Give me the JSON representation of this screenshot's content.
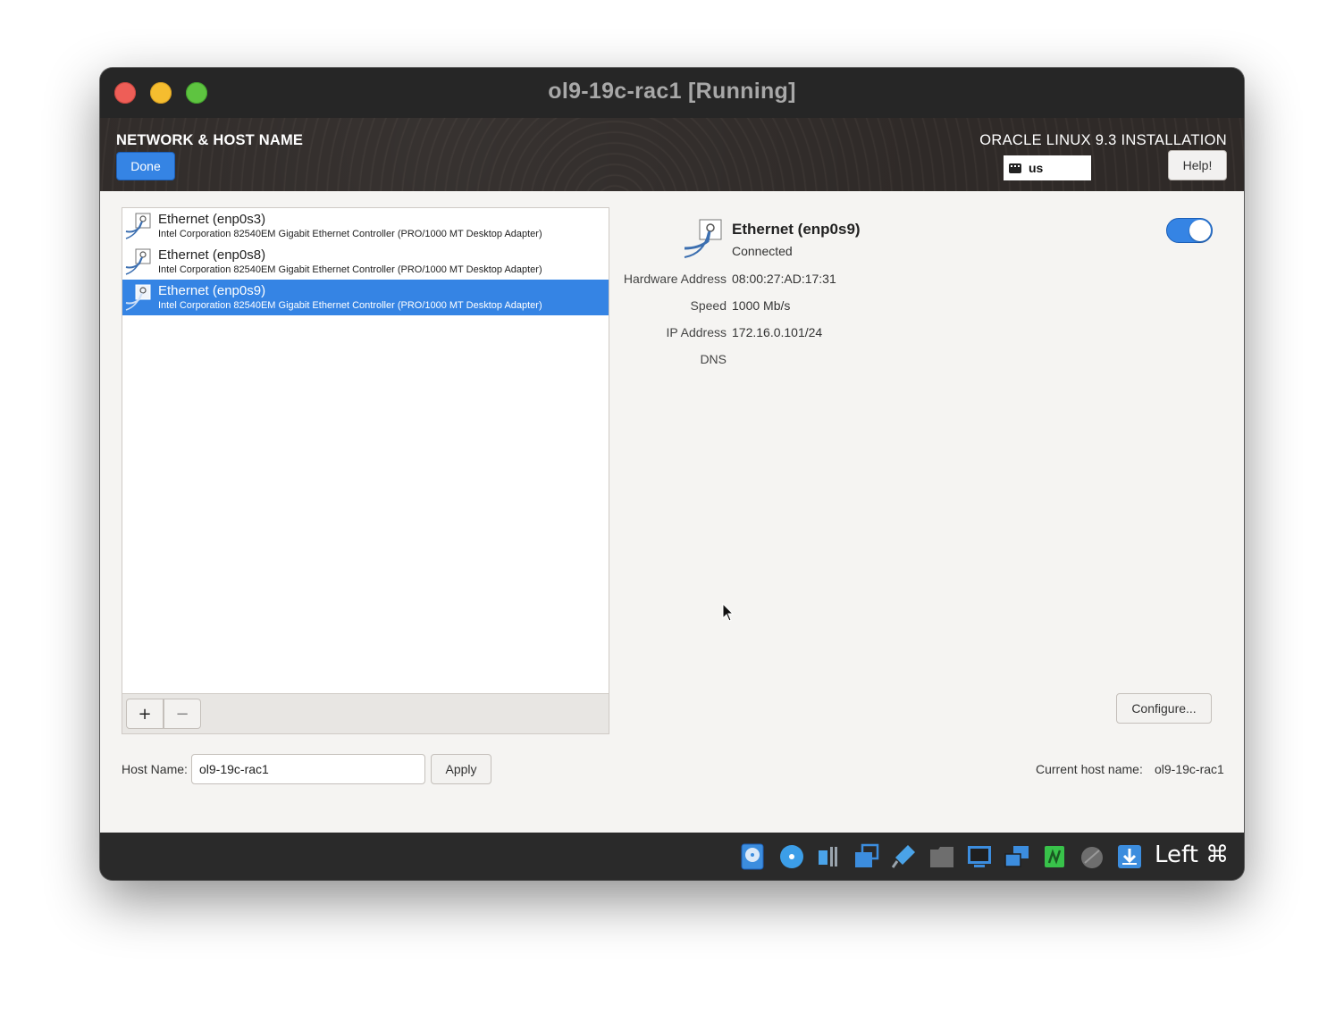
{
  "window": {
    "title": "ol9-19c-rac1 [Running]"
  },
  "header": {
    "spoke_title": "NETWORK & HOST NAME",
    "done_label": "Done",
    "product_title": "ORACLE LINUX 9.3 INSTALLATION",
    "keyboard_layout": "us",
    "help_label": "Help!"
  },
  "devices": [
    {
      "name": "Ethernet (enp0s3)",
      "description": "Intel Corporation 82540EM Gigabit Ethernet Controller (PRO/1000 MT Desktop Adapter)",
      "selected": false
    },
    {
      "name": "Ethernet (enp0s8)",
      "description": "Intel Corporation 82540EM Gigabit Ethernet Controller (PRO/1000 MT Desktop Adapter)",
      "selected": false
    },
    {
      "name": "Ethernet (enp0s9)",
      "description": "Intel Corporation 82540EM Gigabit Ethernet Controller (PRO/1000 MT Desktop Adapter)",
      "selected": true
    }
  ],
  "list_toolbar": {
    "add_label": "+",
    "remove_label": "−"
  },
  "detail": {
    "name": "Ethernet (enp0s9)",
    "status": "Connected",
    "enabled": true,
    "properties": [
      {
        "label": "Hardware Address",
        "value": "08:00:27:AD:17:31"
      },
      {
        "label": "Speed",
        "value": "1000 Mb/s"
      },
      {
        "label": "IP Address",
        "value": "172.16.0.101/24"
      },
      {
        "label": "DNS",
        "value": ""
      }
    ],
    "configure_label": "Configure..."
  },
  "hostname": {
    "label": "Host Name:",
    "value": "ol9-19c-rac1",
    "apply_label": "Apply",
    "current_label": "Current host name:",
    "current_value": "ol9-19c-rac1"
  },
  "statusbar": {
    "icons": [
      "hard-disk-icon",
      "optical-drive-icon",
      "audio-icon",
      "network-icon",
      "usb-icon",
      "shared-folder-icon",
      "display-icon",
      "recording-icon",
      "cpu-icon",
      "mouse-integration-icon",
      "download-icon"
    ],
    "host_key": "Left ⌘"
  },
  "colors": {
    "accent": "#3584e4",
    "header_bg": "#302b28",
    "content_bg": "#f5f4f2"
  }
}
